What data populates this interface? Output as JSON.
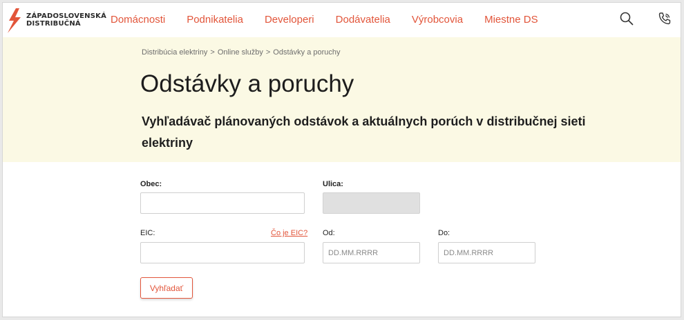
{
  "brand": {
    "line1": "ZÁPADOSLOVENSKÁ",
    "line2": "DISTRIBUČNÁ",
    "accent_color": "#e2553a"
  },
  "nav": {
    "items": [
      {
        "label": "Domácnosti"
      },
      {
        "label": "Podnikatelia"
      },
      {
        "label": "Developeri"
      },
      {
        "label": "Dodávatelia"
      },
      {
        "label": "Výrobcovia"
      },
      {
        "label": "Miestne DS"
      }
    ],
    "icons": [
      "search-icon",
      "phone-icon"
    ]
  },
  "breadcrumb": [
    "Distribúcia elektriny",
    "Online služby",
    "Odstávky a poruchy"
  ],
  "breadcrumb_separator": ">",
  "page": {
    "title": "Odstávky a poruchy",
    "subtitle": "Vyhľadávač plánovaných odstávok a aktuálnych porúch v distribučnej sieti elektriny"
  },
  "form": {
    "obec_label": "Obec:",
    "obec_value": "",
    "ulica_label": "Ulica:",
    "ulica_value": "",
    "eic_label": "EIC:",
    "eic_help": "Čo je EIC?",
    "eic_value": "",
    "od_label": "Od:",
    "od_placeholder": "DD.MM.RRRR",
    "do_label": "Do:",
    "do_placeholder": "DD.MM.RRRR",
    "submit_label": "Vyhľadať"
  },
  "colors": {
    "hero_background": "#fbf9e4",
    "accent": "#e2553a"
  }
}
